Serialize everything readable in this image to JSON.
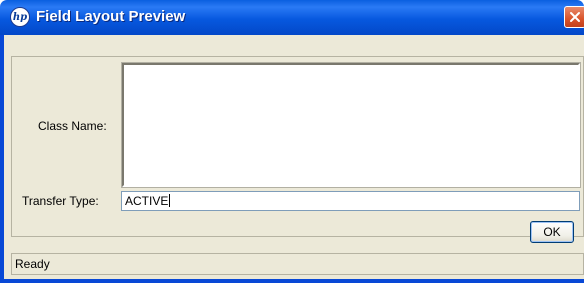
{
  "window": {
    "title": "Field Layout Preview",
    "logo_text": "hp"
  },
  "form": {
    "class_name_label": "Class Name:",
    "class_name_value": "",
    "transfer_type_label": "Transfer Type:",
    "transfer_type_value": "ACTIVE"
  },
  "buttons": {
    "ok_label": "OK"
  },
  "status": {
    "text": "Ready"
  },
  "colors": {
    "title_bar": "#0758df",
    "dialog_background": "#ece9d8",
    "close_button": "#d9532a"
  },
  "icons": {
    "app": "hp-logo-icon",
    "close": "close-icon"
  }
}
